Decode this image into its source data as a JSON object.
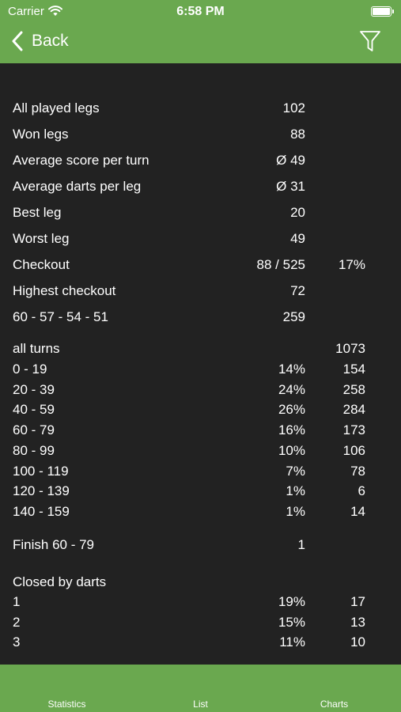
{
  "status_bar": {
    "carrier": "Carrier",
    "time": "6:58 PM"
  },
  "nav": {
    "back_label": "Back"
  },
  "summary": [
    {
      "label": "All played legs",
      "value": "102",
      "extra": ""
    },
    {
      "label": "Won legs",
      "value": "88",
      "extra": ""
    },
    {
      "label": "Average score per turn",
      "value": "Ø 49",
      "extra": ""
    },
    {
      "label": "Average darts per leg",
      "value": "Ø 31",
      "extra": ""
    },
    {
      "label": "Best leg",
      "value": "20",
      "extra": ""
    },
    {
      "label": "Worst leg",
      "value": "49",
      "extra": ""
    },
    {
      "label": "Checkout",
      "value": "88 / 525",
      "extra": "17%"
    },
    {
      "label": "Highest checkout",
      "value": "72",
      "extra": ""
    },
    {
      "label": "60 - 57 - 54 - 51",
      "value": "259",
      "extra": ""
    }
  ],
  "turns": {
    "header_label": "all turns",
    "header_total": "1073",
    "rows": [
      {
        "range": "0 - 19",
        "percent": "14%",
        "count": "154"
      },
      {
        "range": "20 - 39",
        "percent": "24%",
        "count": "258"
      },
      {
        "range": "40 - 59",
        "percent": "26%",
        "count": "284"
      },
      {
        "range": "60 - 79",
        "percent": "16%",
        "count": "173"
      },
      {
        "range": "80 - 99",
        "percent": "10%",
        "count": "106"
      },
      {
        "range": "100 - 119",
        "percent": "7%",
        "count": "78"
      },
      {
        "range": "120 - 139",
        "percent": "1%",
        "count": "6"
      },
      {
        "range": "140 - 159",
        "percent": "1%",
        "count": "14"
      }
    ]
  },
  "finish": {
    "label": "Finish 60 - 79",
    "value": "1"
  },
  "closed_by": {
    "title": "Closed by darts",
    "rows": [
      {
        "darts": "1",
        "percent": "19%",
        "count": "17"
      },
      {
        "darts": "2",
        "percent": "15%",
        "count": "13"
      },
      {
        "darts": "3",
        "percent": "11%",
        "count": "10"
      }
    ]
  },
  "tabs": [
    {
      "label": "Statistics"
    },
    {
      "label": "List"
    },
    {
      "label": "Charts"
    }
  ],
  "colors": {
    "accent": "#6aa84f",
    "background": "#222222",
    "text": "#ffffff"
  },
  "icons": {
    "back": "chevron-left-icon",
    "filter": "filter-icon",
    "wifi": "wifi-icon",
    "battery": "battery-icon"
  }
}
